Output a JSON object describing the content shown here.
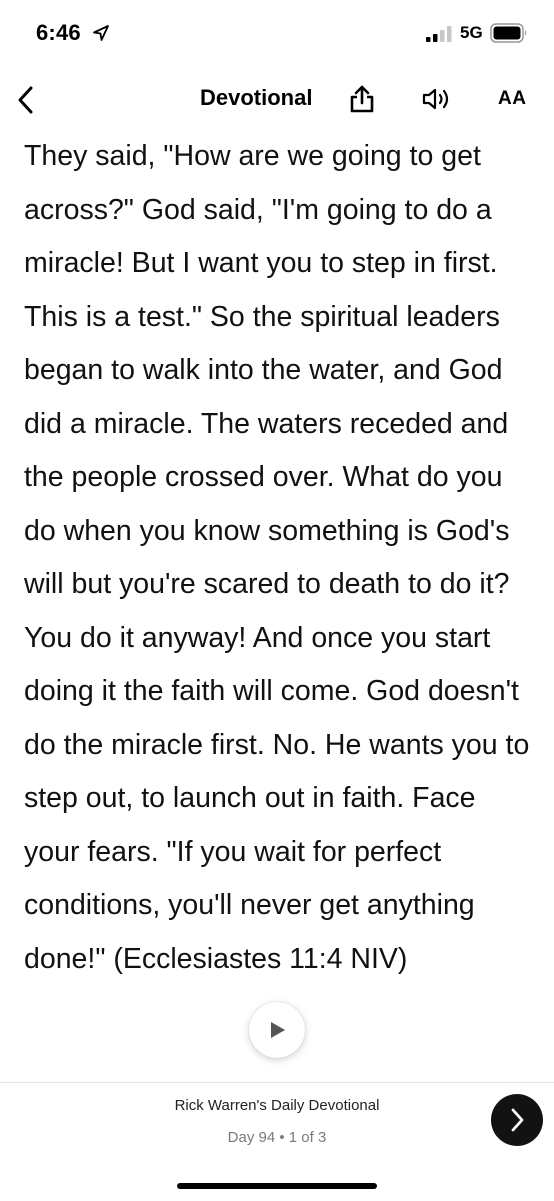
{
  "status_bar": {
    "time": "6:46",
    "network": "5G"
  },
  "header": {
    "title": "Devotional",
    "text_size_label": "AA"
  },
  "content": {
    "body": "They said, \"How are we going to get across?\" God said, \"I'm going to do a miracle! But I want you to step in first. This is a test.\" So the spiritual leaders began to walk into the water, and God did a miracle. The waters receded and the people crossed over. What do you do when you know something is God's will but you're scared to death to do it? You do it anyway! And once you start doing it the faith will come. God doesn't do the miracle first. No. He wants you to step out, to launch out in faith. Face your fears. \"If you wait for perfect conditions, you'll never get anything done!\" (Ecclesiastes 11:4 NIV)"
  },
  "footer": {
    "plan_title": "Rick Warren's Daily Devotional",
    "progress": "Day 94 • 1 of 3"
  },
  "icons": {
    "location": "location-arrow-icon",
    "signal": "cellular-signal-icon",
    "battery": "battery-icon",
    "back": "chevron-left-icon",
    "share": "share-icon",
    "audio": "speaker-icon",
    "play": "play-icon",
    "next": "chevron-right-icon"
  },
  "colors": {
    "background": "#ffffff",
    "text": "#111111",
    "next_button": "#121212",
    "secondary_text": "#7a7a7a"
  }
}
